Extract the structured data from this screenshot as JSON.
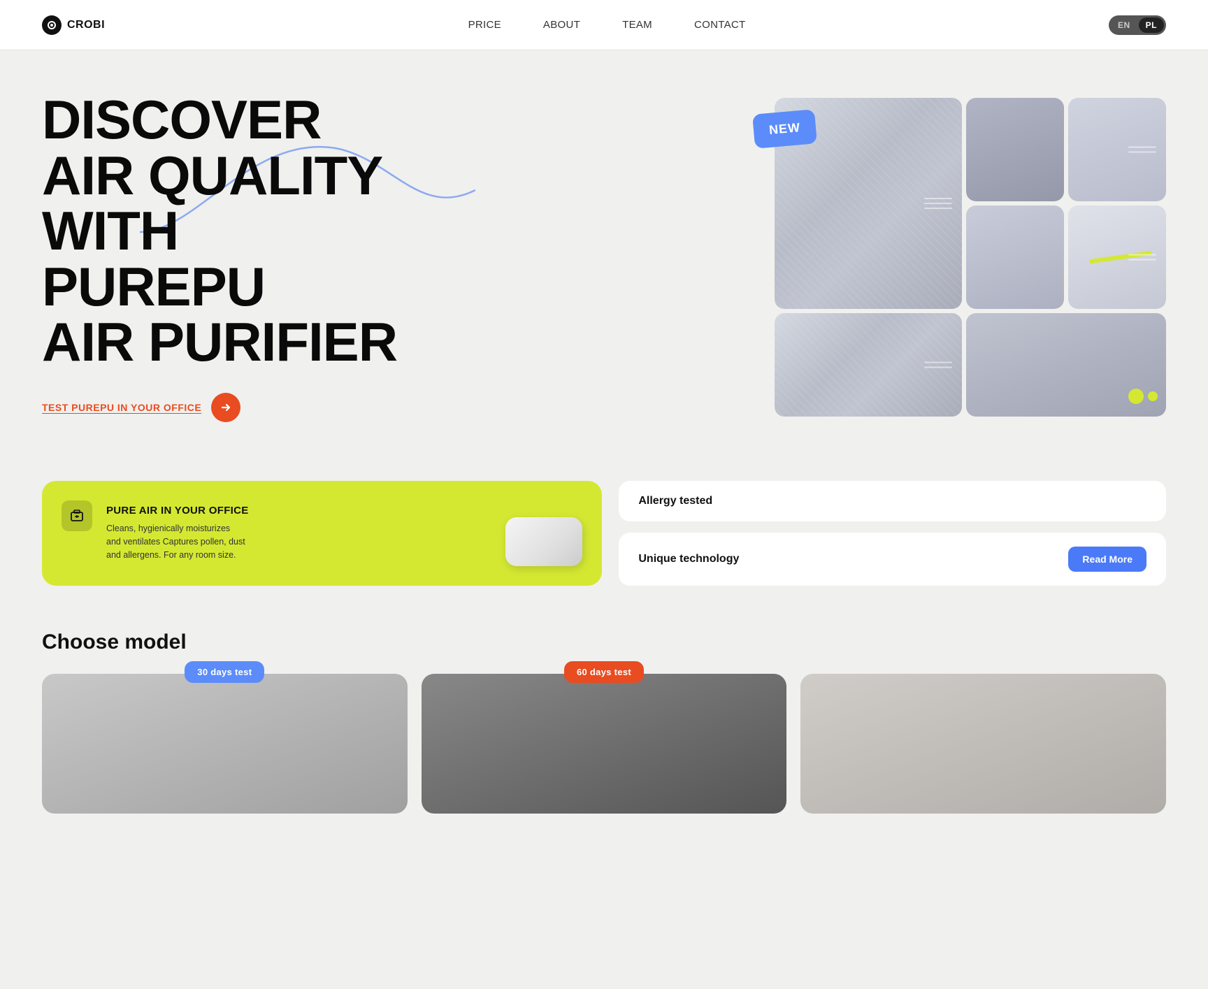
{
  "nav": {
    "logo_text": "CROBI",
    "links": [
      {
        "label": "PRICE",
        "id": "price"
      },
      {
        "label": "ABOUT",
        "id": "about"
      },
      {
        "label": "TEAM",
        "id": "team"
      },
      {
        "label": "CONTACT",
        "id": "contact"
      }
    ],
    "lang_en": "EN",
    "lang_pl": "PL"
  },
  "hero": {
    "badge": "NEW",
    "title": "DISCOVER\nAIR QUALITY\nWITH PUREPU\nAIR PURIFIER",
    "cta_text": "TEST PUREPU IN YOUR OFFICE"
  },
  "features": {
    "card_green": {
      "title": "PURE AIR IN YOUR OFFICE",
      "description": "Cleans, hygienically moisturizes and ventilates Captures pollen, dust and allergens. For any room size."
    },
    "card_allergy": {
      "label": "Allergy tested"
    },
    "card_tech": {
      "label": "Unique technology",
      "button": "Read More"
    }
  },
  "choose": {
    "title": "Choose model",
    "models": [
      {
        "badge": "30 days test",
        "badge_type": "blue"
      },
      {
        "badge": "60 days test",
        "badge_type": "orange"
      },
      {
        "badge": null,
        "badge_type": null
      }
    ]
  }
}
